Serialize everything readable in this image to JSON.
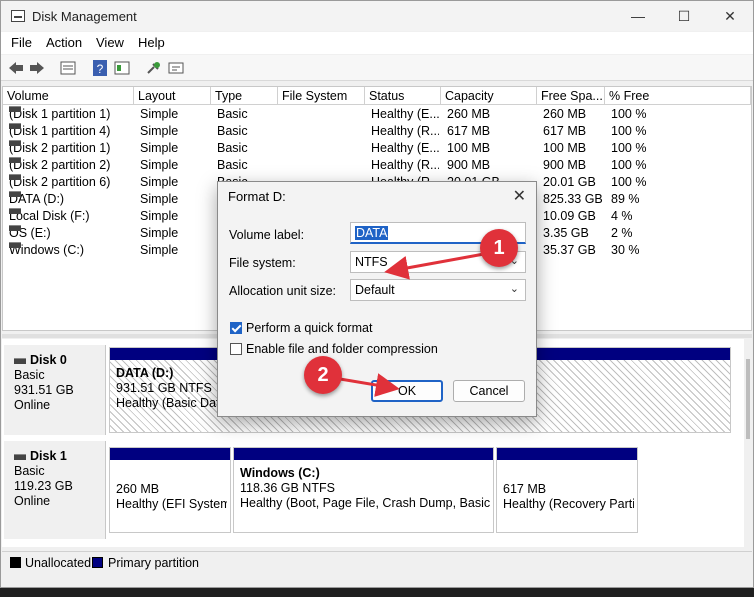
{
  "window": {
    "title": "Disk Management",
    "min": "—",
    "max": "☐",
    "close": "✕"
  },
  "menu": [
    "File",
    "Action",
    "View",
    "Help"
  ],
  "volume_list": {
    "columns": [
      "Volume",
      "Layout",
      "Type",
      "File System",
      "Status",
      "Capacity",
      "Free Spa...",
      "% Free"
    ],
    "rows": [
      [
        "(Disk 1 partition 1)",
        "Simple",
        "Basic",
        "",
        "Healthy (E...",
        "260 MB",
        "260 MB",
        "100 %"
      ],
      [
        "(Disk 1 partition 4)",
        "Simple",
        "Basic",
        "",
        "Healthy (R...",
        "617 MB",
        "617 MB",
        "100 %"
      ],
      [
        "(Disk 2 partition 1)",
        "Simple",
        "Basic",
        "",
        "Healthy (E...",
        "100 MB",
        "100 MB",
        "100 %"
      ],
      [
        "(Disk 2 partition 2)",
        "Simple",
        "Basic",
        "",
        "Healthy (R...",
        "900 MB",
        "900 MB",
        "100 %"
      ],
      [
        "(Disk 2 partition 6)",
        "Simple",
        "Basic",
        "",
        "Healthy (R...",
        "20.01 GB",
        "20.01 GB",
        "100 %"
      ],
      [
        "DATA (D:)",
        "Simple",
        "Basic",
        "",
        "",
        "",
        "825.33 GB",
        "89 %"
      ],
      [
        "Local Disk (F:)",
        "Simple",
        "Basic",
        "",
        "",
        "",
        "10.09 GB",
        "4 %"
      ],
      [
        "OS (E:)",
        "Simple",
        "Basic",
        "",
        "",
        "",
        "3.35 GB",
        "2 %"
      ],
      [
        "Windows (C:)",
        "Simple",
        "Basic",
        "",
        "",
        "",
        "35.37 GB",
        "30 %"
      ]
    ]
  },
  "disks": [
    {
      "name": "Disk 0",
      "type": "Basic",
      "size": "931.51 GB",
      "state": "Online",
      "partitions": [
        {
          "name": "DATA  (D:)",
          "size": "931.51 GB NTFS",
          "status": "Healthy (Basic Data Partition)"
        }
      ]
    },
    {
      "name": "Disk 1",
      "type": "Basic",
      "size": "119.23 GB",
      "state": "Online",
      "partitions": [
        {
          "name": "",
          "size": "260 MB",
          "status": "Healthy (EFI System Partition)"
        },
        {
          "name": "Windows  (C:)",
          "size": "118.36 GB NTFS",
          "status": "Healthy (Boot, Page File, Crash Dump, Basic Data Partition)"
        },
        {
          "name": "",
          "size": "617 MB",
          "status": "Healthy (Recovery Partition)"
        }
      ]
    }
  ],
  "legend": [
    "Unallocated",
    "Primary partition"
  ],
  "dialog": {
    "title": "Format D:",
    "volume_label": {
      "label": "Volume label:",
      "value": "DATA"
    },
    "file_system": {
      "label": "File system:",
      "value": "NTFS"
    },
    "allocation": {
      "label": "Allocation unit size:",
      "value": "Default"
    },
    "quick_format": {
      "label": "Perform a quick format",
      "checked": true
    },
    "compression": {
      "label": "Enable file and folder compression",
      "checked": false
    },
    "ok": "OK",
    "cancel": "Cancel"
  },
  "annotations": [
    "1",
    "2"
  ],
  "colors": {
    "primary_partition": "#000080",
    "annotation": "#e0313a",
    "accent": "#1f63c6"
  }
}
